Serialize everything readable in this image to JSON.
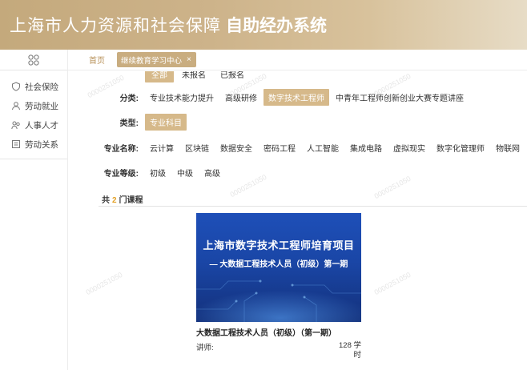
{
  "header": {
    "title": "上海市人力资源和社会保障",
    "subtitle": "自助经办系统"
  },
  "sidebar": {
    "items": [
      {
        "label": "社会保险",
        "icon": "insurance-icon"
      },
      {
        "label": "劳动就业",
        "icon": "employment-icon"
      },
      {
        "label": "人事人才",
        "icon": "talent-icon"
      },
      {
        "label": "劳动关系",
        "icon": "relations-icon"
      }
    ]
  },
  "tabs": {
    "home": "首页",
    "active": "继续教育学习中心",
    "close": "×"
  },
  "filters": {
    "status": [
      "全部",
      "未报名",
      "已报名"
    ],
    "category": {
      "label": "分类:",
      "options": [
        "专业技术能力提升",
        "高级研修",
        "数字技术工程师",
        "中青年工程师创新创业大赛专题讲座"
      ],
      "selected": "数字技术工程师"
    },
    "type": {
      "label": "类型:",
      "options": [
        "专业科目"
      ]
    },
    "major": {
      "label": "专业名称:",
      "options": [
        "云计算",
        "区块链",
        "数据安全",
        "密码工程",
        "人工智能",
        "集成电路",
        "虚拟现实",
        "数字化管理师",
        "物联网"
      ]
    },
    "level": {
      "label": "专业等级:",
      "options": [
        "初级",
        "中级",
        "高级"
      ]
    }
  },
  "results": {
    "prefix": "共",
    "count": "2",
    "suffix": "门课程"
  },
  "course": {
    "cover_title": "上海市数字技术工程师培育项目",
    "cover_subtitle": "— 大数据工程技术人员（初级）第一期",
    "name": "大数据工程技术人员（初级）（第一期）",
    "teacher_label": "讲师:",
    "hours_value": "128 学",
    "hours_unit": "时"
  },
  "watermark": "0000251050",
  "colors": {
    "accent": "#c9ad80",
    "selected": "#d6b98a",
    "count": "#e3a127",
    "cover": "#1a46a6"
  }
}
